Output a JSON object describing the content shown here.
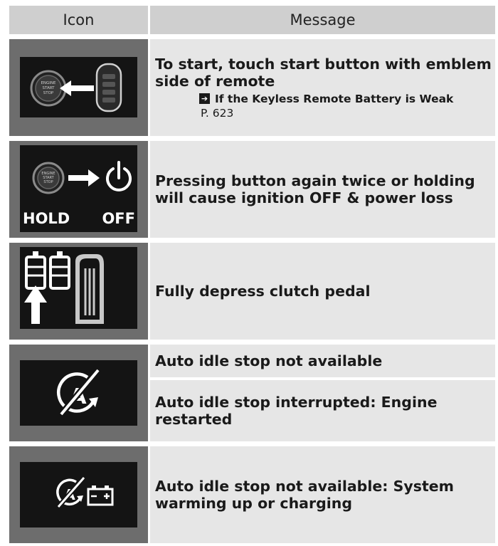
{
  "header": {
    "icon_col": "Icon",
    "message_col": "Message"
  },
  "rows": [
    {
      "message": "To start, touch start button with emblem side of remote",
      "ref_title": "If the Keyless Remote Battery is Weak",
      "ref_page": "P. 623",
      "icon_text": [
        "ENGINE",
        "START",
        "STOP"
      ]
    },
    {
      "message": "Pressing button again twice or holding will cause ignition OFF & power loss",
      "icon_text": [
        "ENGINE",
        "START",
        "STOP"
      ],
      "icon_labels": {
        "left": "HOLD",
        "right": "OFF"
      }
    },
    {
      "message": "Fully depress clutch pedal"
    },
    {
      "messages": [
        "Auto idle stop not available",
        "Auto idle stop interrupted: Engine restarted"
      ]
    },
    {
      "message": "Auto idle stop not available: System warming up or charging"
    }
  ],
  "colors": {
    "header_bg": "#cfcfcf",
    "icon_frame": "#6d6d6d",
    "icon_screen": "#141414",
    "message_bg": "#e6e6e6"
  },
  "icons": [
    "remote-touch-start-icon",
    "hold-off-icon",
    "clutch-pedal-icon",
    "auto-idle-stop-off-icon",
    "auto-idle-stop-battery-icon"
  ]
}
